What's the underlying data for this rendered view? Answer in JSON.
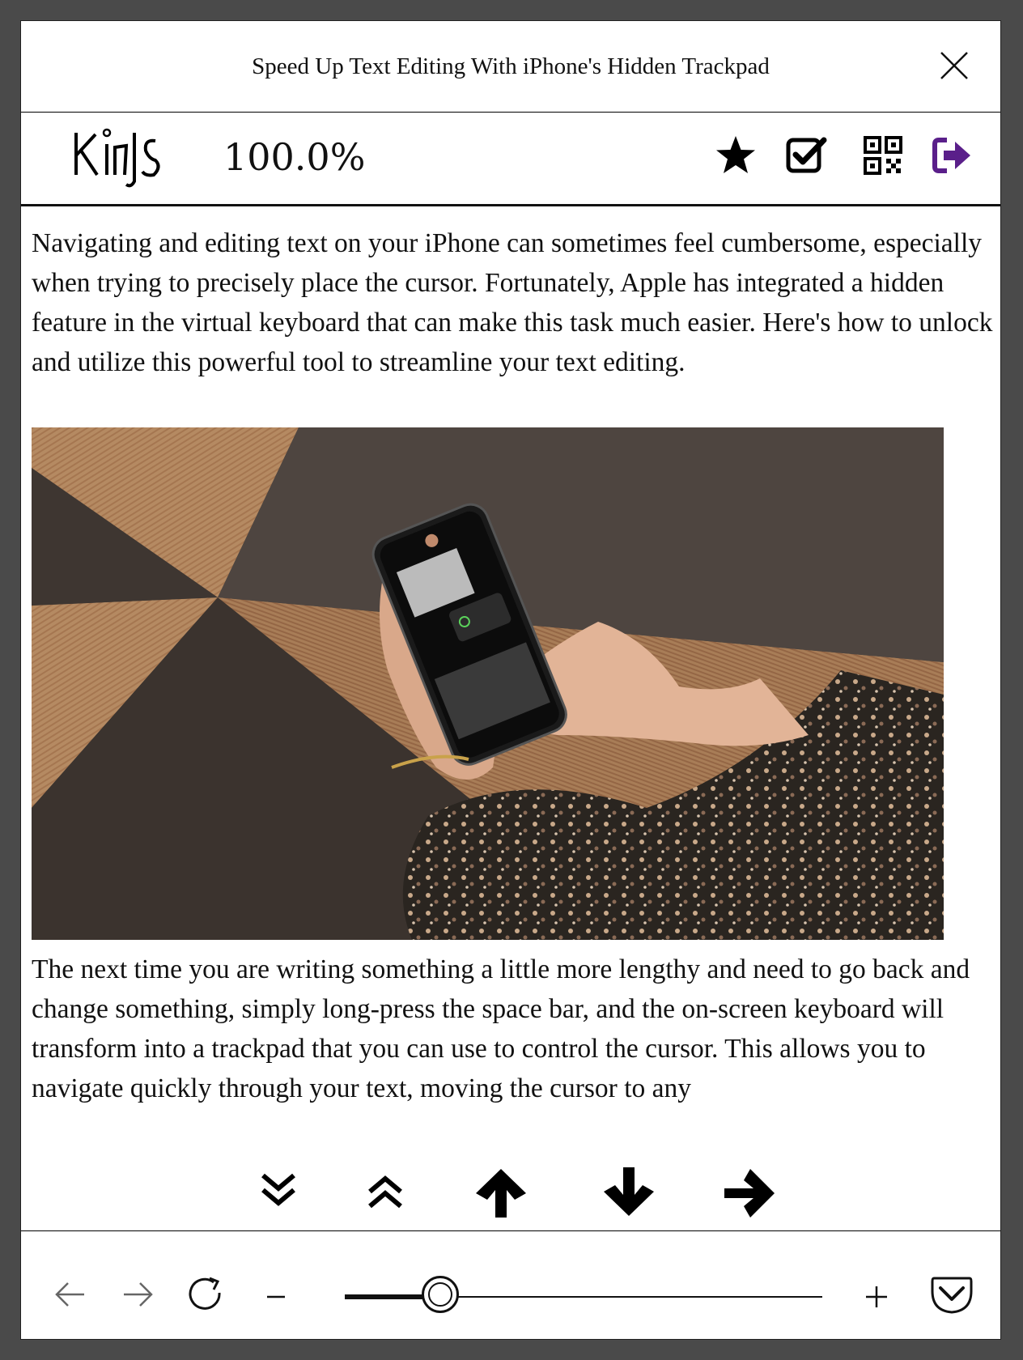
{
  "window": {
    "title": "Speed Up Text Editing With iPhone's Hidden Trackpad"
  },
  "toolbar": {
    "logo_text": "Kinds",
    "zoom_label": "100.0%",
    "icons": [
      "star-icon",
      "checkbox-icon",
      "qr-code-icon",
      "exit-icon"
    ],
    "accent_color": "#5a1f8a"
  },
  "article": {
    "paragraph_1": "Navigating and editing text on your iPhone can sometimes feel cumbersome, especially when trying to precisely place the cursor. Fortunately, Apple has integrated a hidden feature in the virtual keyboard that can make this task much easier. Here's how to unlock and utilize this powerful tool to streamline your text editing.",
    "paragraph_2": "The next time you are writing something a little more lengthy and need to go back and change something, simply long-press the space bar, and the on-screen keyboard will transform into a trackpad that you can use to control the cursor. This allows you to navigate quickly through your text, moving the cursor to any"
  },
  "scroll_controls": {
    "icons": [
      "page-down-icon",
      "page-up-icon",
      "arrow-up-icon",
      "arrow-down-icon",
      "arrow-right-icon"
    ]
  },
  "bottom_nav": {
    "icons": [
      "back-icon",
      "forward-icon",
      "reload-icon",
      "zoom-out-icon",
      "zoom-in-icon",
      "pocket-icon"
    ],
    "slider_value": 0.2
  }
}
